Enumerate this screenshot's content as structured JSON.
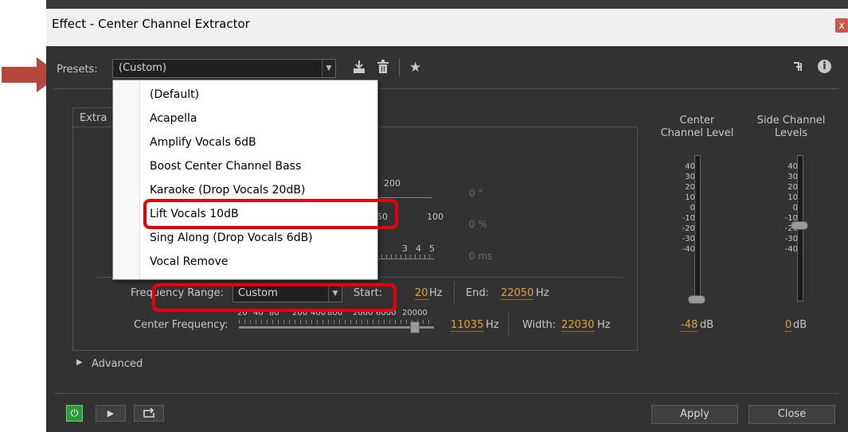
{
  "window": {
    "title": "Effect - Center Channel Extractor",
    "close_glyph": "x"
  },
  "presets": {
    "label": "Presets:",
    "selected": "(Custom)",
    "menu_items": [
      "(Default)",
      "Acapella",
      "Amplify Vocals 6dB",
      "Boost Center Channel Bass",
      "Karaoke (Drop Vocals 20dB)",
      "Lift Vocals 10dB",
      "Sing Along (Drop Vocals 6dB)",
      "Vocal Remove"
    ]
  },
  "tab": {
    "label_partial": "Extra"
  },
  "hidden_controls": {
    "scale1_label": "200",
    "value1": "0 °",
    "scale2_left": "50",
    "scale2_right": "100",
    "value2": "0 %",
    "scale3_a": "3",
    "scale3_b": "4",
    "scale3_c": "5",
    "value3": "0 ms"
  },
  "frequency": {
    "range_label": "Frequency Range:",
    "range_value": "Custom",
    "start_label": "Start:",
    "start_value": "20",
    "start_unit": "Hz",
    "end_label": "End:",
    "end_value": "22050",
    "end_unit": "Hz",
    "center_label": "Center Frequency:",
    "center_scale": [
      "20",
      "40",
      "80",
      "200",
      "400",
      "800",
      "2000",
      "6000",
      "20000"
    ],
    "center_value": "11035",
    "center_unit": "Hz",
    "width_label": "Width:",
    "width_value": "22030",
    "width_unit": "Hz"
  },
  "meters": {
    "center_title_1": "Center",
    "center_title_2": "Channel Level",
    "side_title_1": "Side Channel",
    "side_title_2": "Levels",
    "ticks": [
      "40",
      "30",
      "20",
      "10",
      "0",
      "-10",
      "-20",
      "-30",
      "-40"
    ],
    "center_value": "-48",
    "side_value": "0",
    "unit": "dB"
  },
  "advanced_label": "Advanced",
  "buttons": {
    "apply": "Apply",
    "close": "Close"
  },
  "icons": [
    "power-icon",
    "play-icon",
    "loop-icon",
    "save-preset-icon",
    "delete-preset-icon",
    "favorite-star-icon",
    "routing-icon",
    "info-icon"
  ],
  "colors": {
    "accent": "#e5a42b",
    "highlight_box": "#e8000a",
    "annotation_arrow": "#b5473b",
    "power_green": "#3fc14a"
  }
}
